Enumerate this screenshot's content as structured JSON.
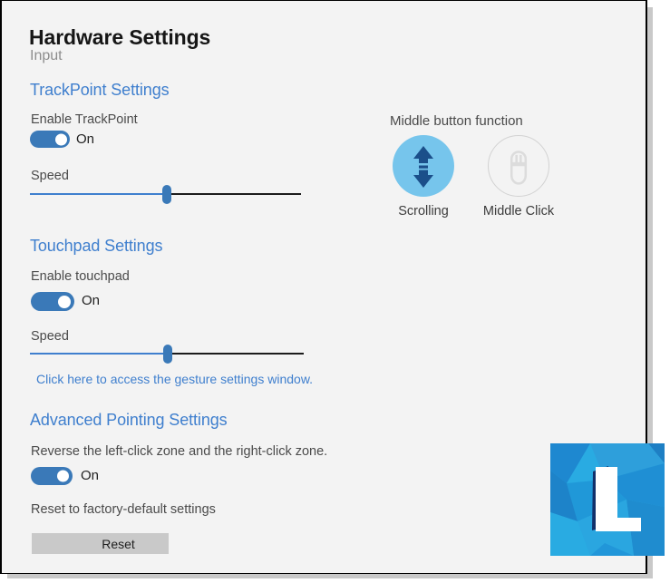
{
  "window": {
    "title": "Hardware Settings",
    "subtitle": "Input"
  },
  "trackpoint": {
    "heading": "TrackPoint Settings",
    "enable_label": "Enable TrackPoint",
    "enable_state": "On",
    "speed_label": "Speed",
    "speed_value": 50
  },
  "middle_button": {
    "heading": "Middle button function",
    "options": [
      {
        "label": "Scrolling",
        "icon": "scroll-arrows-icon",
        "selected": true
      },
      {
        "label": "Middle Click",
        "icon": "mouse-icon",
        "selected": false
      }
    ]
  },
  "touchpad": {
    "heading": "Touchpad Settings",
    "enable_label": "Enable touchpad",
    "enable_state": "On",
    "speed_label": "Speed",
    "speed_value": 50,
    "gesture_link": "Click here to access the gesture settings window."
  },
  "advanced": {
    "heading": "Advanced Pointing Settings",
    "reverse_label": "Reverse the left-click zone and the right-click zone.",
    "reverse_state": "On",
    "reset_label": "Reset to factory-default settings",
    "reset_button": "Reset"
  },
  "branding": {
    "logo_letter": "L",
    "logo_name": "lenovo-logo"
  },
  "colors": {
    "accent_blue": "#3f7fce",
    "toggle_blue": "#3a79b8",
    "selected_circle": "#76c5ec",
    "icon_dark_blue": "#1b4f8a",
    "window_bg": "#f3f3f3",
    "button_gray": "#c9c9c9"
  }
}
